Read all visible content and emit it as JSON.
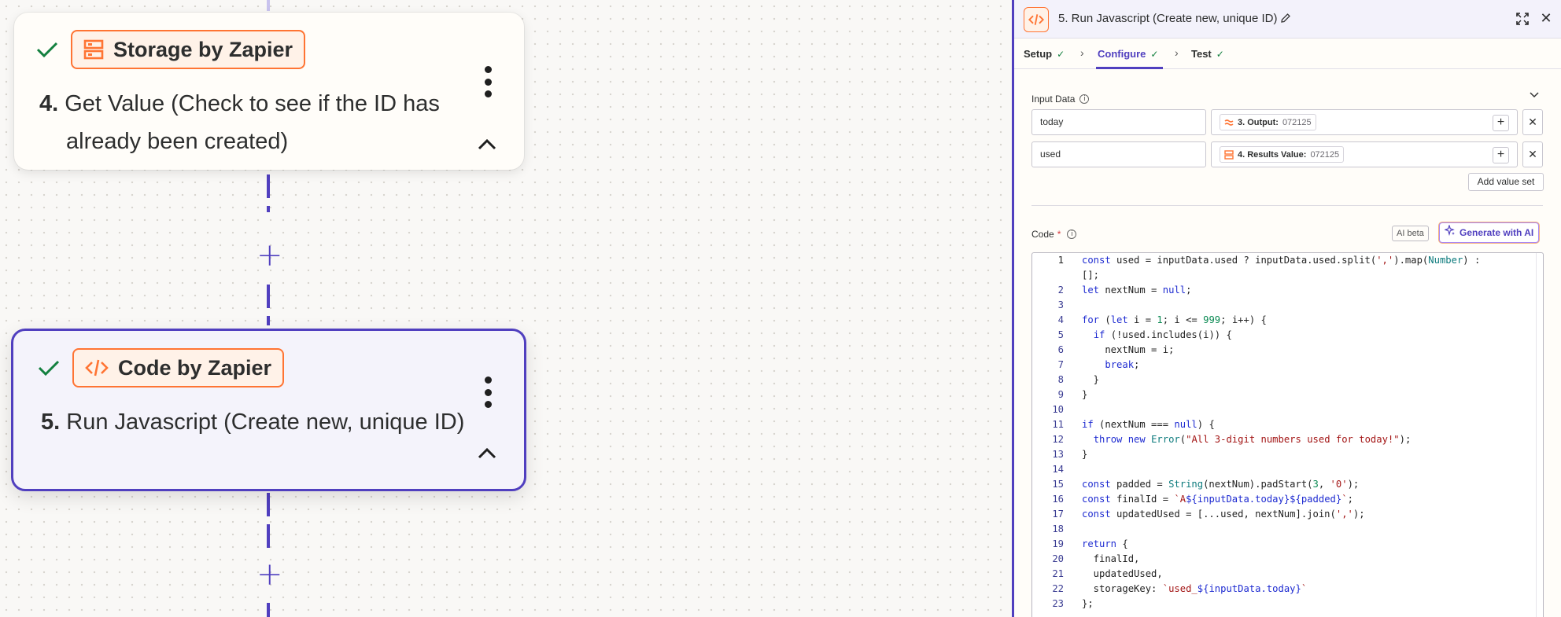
{
  "canvas": {
    "steps": [
      {
        "app_name": "Storage by Zapier",
        "step_number": "4.",
        "title": "Get Value (Check to see if the ID has already been created)",
        "app_icon": "storage-icon",
        "status_icon": "check-icon"
      },
      {
        "app_name": "Code by Zapier",
        "step_number": "5.",
        "title": "Run Javascript (Create new, unique ID)",
        "app_icon": "code-icon",
        "status_icon": "check-icon"
      }
    ],
    "plus_glyph": "+"
  },
  "panel": {
    "title": "5. Run Javascript (Create new, unique ID)",
    "tabs": [
      {
        "label": "Setup"
      },
      {
        "label": "Configure"
      },
      {
        "label": "Test"
      }
    ],
    "active_tab": "Configure",
    "input_data": {
      "label": "Input Data",
      "rows": [
        {
          "key": "today",
          "token_label": "3. Output:",
          "token_value": "072125",
          "token_icon": "formatter-icon"
        },
        {
          "key": "used",
          "token_label": "4. Results Value:",
          "token_value": "072125",
          "token_icon": "storage-icon"
        }
      ],
      "add_value_set": "Add value set"
    },
    "code": {
      "label": "Code",
      "required_marker": "*",
      "ai_beta": "AI beta",
      "generate_with_ai": "Generate with AI",
      "lines": [
        {
          "no": "1",
          "text": "const used = inputData.used ? inputData.used.split(',').map(Number) :"
        },
        {
          "no": "",
          "text": "[];"
        },
        {
          "no": "2",
          "text": "let nextNum = null;"
        },
        {
          "no": "3",
          "text": ""
        },
        {
          "no": "4",
          "text": "for (let i = 1; i <= 999; i++) {"
        },
        {
          "no": "5",
          "text": "  if (!used.includes(i)) {"
        },
        {
          "no": "6",
          "text": "    nextNum = i;"
        },
        {
          "no": "7",
          "text": "    break;"
        },
        {
          "no": "8",
          "text": "  }"
        },
        {
          "no": "9",
          "text": "}"
        },
        {
          "no": "10",
          "text": ""
        },
        {
          "no": "11",
          "text": "if (nextNum === null) {"
        },
        {
          "no": "12",
          "text": "  throw new Error(\"All 3-digit numbers used for today!\");"
        },
        {
          "no": "13",
          "text": "}"
        },
        {
          "no": "14",
          "text": ""
        },
        {
          "no": "15",
          "text": "const padded = String(nextNum).padStart(3, '0');"
        },
        {
          "no": "16",
          "text": "const finalId = `A${inputData.today}${padded}`;"
        },
        {
          "no": "17",
          "text": "const updatedUsed = [...used, nextNum].join(',');"
        },
        {
          "no": "18",
          "text": ""
        },
        {
          "no": "19",
          "text": "return {"
        },
        {
          "no": "20",
          "text": "  finalId,"
        },
        {
          "no": "21",
          "text": "  updatedUsed,"
        },
        {
          "no": "22",
          "text": "  storageKey: `used_${inputData.today}`"
        },
        {
          "no": "23",
          "text": "};"
        }
      ]
    }
  },
  "colors": {
    "accent": "#503fbf",
    "app_orange": "#ff7433",
    "success_green": "#13803f"
  }
}
